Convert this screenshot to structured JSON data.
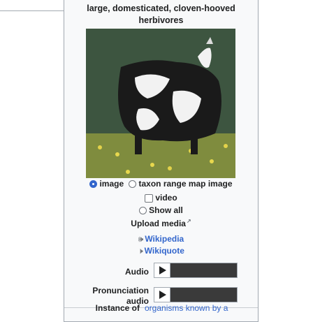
{
  "infobox": {
    "caption": "large, domesticated, cloven-hooved herbivores",
    "image_selector": {
      "options": [
        {
          "label": "image",
          "selected": true
        },
        {
          "label": "taxon range map image",
          "selected": false
        }
      ],
      "video_label": "video",
      "show_all_label": "Show all"
    },
    "upload_label": "Upload media",
    "projects": [
      {
        "label": "Wikipedia",
        "icon": "wikipedia-icon"
      },
      {
        "label": "Wikiquote",
        "icon": "wikiquote-icon"
      }
    ],
    "audio": {
      "label": "Audio"
    },
    "pronunciation": {
      "label_line1": "Pronunciation",
      "label_line2": "audio"
    },
    "instance_of": {
      "label": "Instance of",
      "value": "organisms known by a"
    }
  },
  "colors": {
    "link": "#3366cc",
    "border": "#a2a9b1",
    "infobox_bg": "#f8f9fa",
    "radio_selected": "#3366cc"
  }
}
